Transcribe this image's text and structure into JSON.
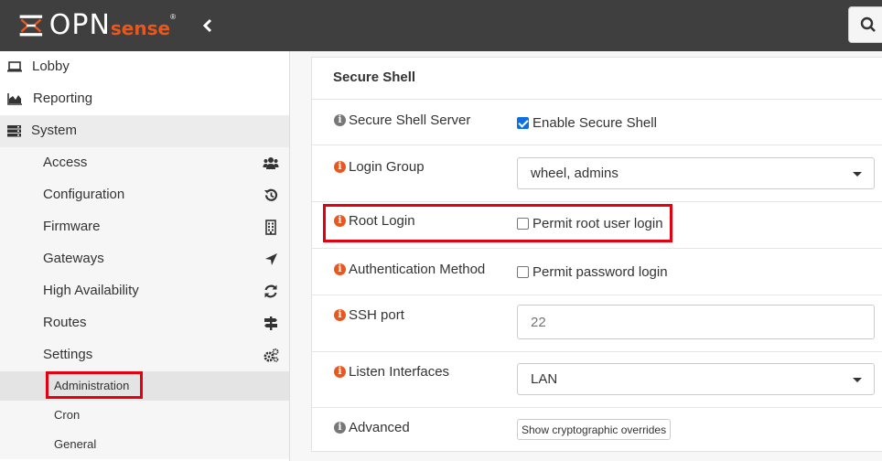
{
  "header": {
    "logo_primary": "OPN",
    "logo_secondary": "sense",
    "logo_reg": "®",
    "colors": {
      "navbar": "#3f3f3f",
      "brand_orange": "#e8571e"
    }
  },
  "sidebar": {
    "top_items": [
      {
        "label": "Lobby",
        "icon": "laptop-icon"
      },
      {
        "label": "Reporting",
        "icon": "area-chart-icon"
      },
      {
        "label": "System",
        "icon": "server-icon"
      }
    ],
    "system_items": [
      {
        "label": "Access",
        "icon": "users-icon"
      },
      {
        "label": "Configuration",
        "icon": "history-icon"
      },
      {
        "label": "Firmware",
        "icon": "building-icon"
      },
      {
        "label": "Gateways",
        "icon": "location-arrow-icon"
      },
      {
        "label": "High Availability",
        "icon": "refresh-icon"
      },
      {
        "label": "Routes",
        "icon": "signpost-icon"
      },
      {
        "label": "Settings",
        "icon": "gears-icon"
      }
    ],
    "settings_items": [
      {
        "label": "Administration",
        "active": true
      },
      {
        "label": "Cron"
      },
      {
        "label": "General"
      }
    ]
  },
  "panel": {
    "title": "Secure Shell",
    "rows": {
      "server": {
        "label": "Secure Shell Server",
        "checkbox_label": "Enable Secure Shell",
        "checked": true
      },
      "login_group": {
        "label": "Login Group",
        "value": "wheel, admins"
      },
      "root_login": {
        "label": "Root Login",
        "checkbox_label": "Permit root user login",
        "checked": false
      },
      "auth_method": {
        "label": "Authentication Method",
        "checkbox_label": "Permit password login",
        "checked": false
      },
      "ssh_port": {
        "label": "SSH port",
        "placeholder": "22"
      },
      "listen": {
        "label": "Listen Interfaces",
        "value": "LAN"
      },
      "advanced": {
        "label": "Advanced",
        "button_label": "Show cryptographic overrides"
      }
    }
  }
}
